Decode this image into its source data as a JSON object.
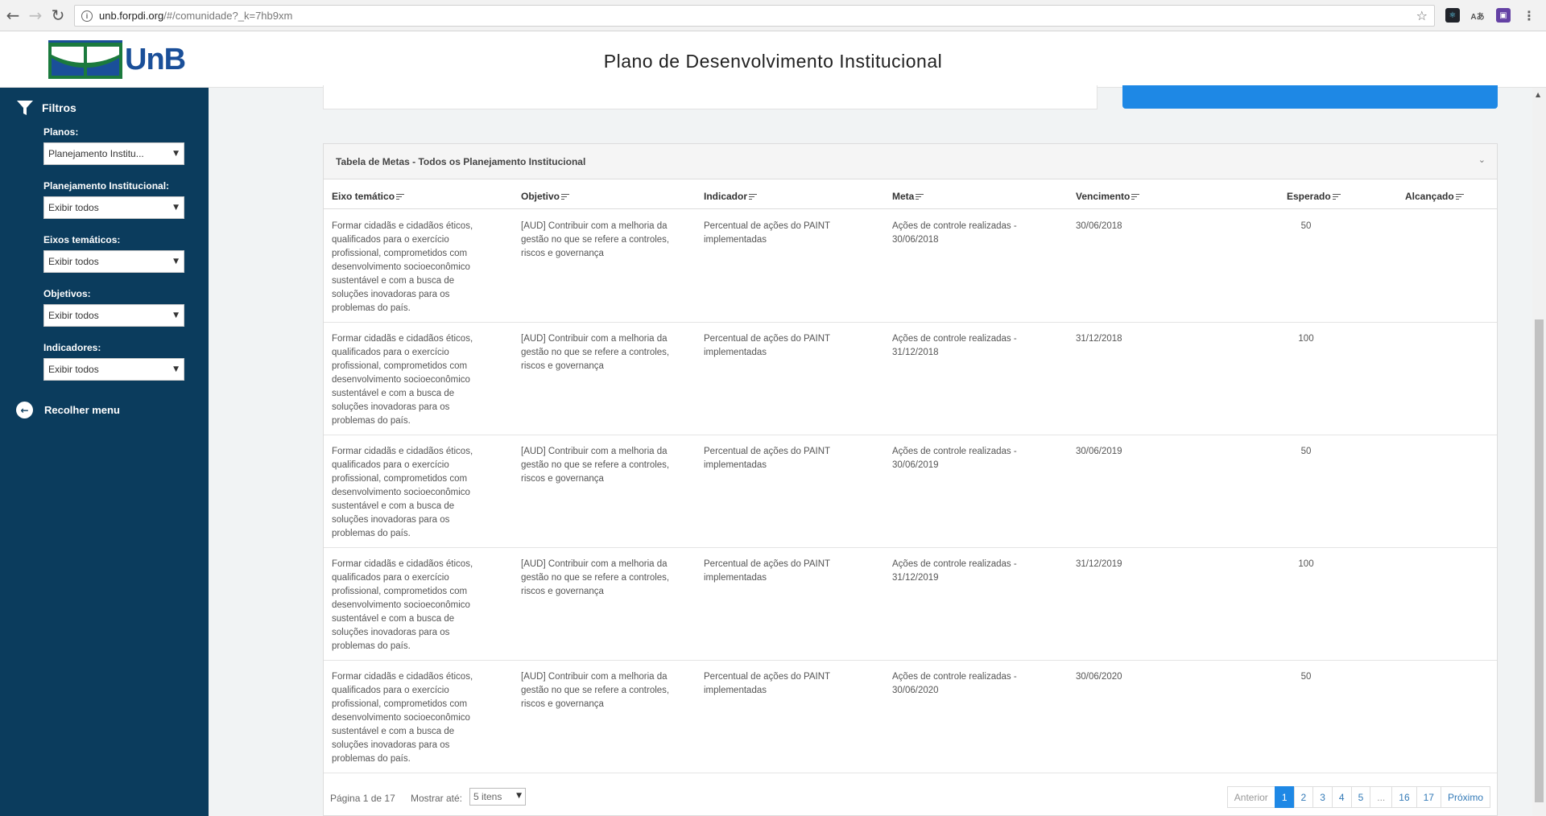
{
  "browser": {
    "url_host": "unb.forpdi.org",
    "url_path": "/#/comunidade?_k=7hb9xm"
  },
  "header": {
    "logo_text": "UnB",
    "title": "Plano de Desenvolvimento Institucional"
  },
  "sidebar": {
    "filters_title": "Filtros",
    "filters": [
      {
        "label": "Planos:",
        "value": "Planejamento Institu..."
      },
      {
        "label": "Planejamento Institucional:",
        "value": "Exibir todos"
      },
      {
        "label": "Eixos temáticos:",
        "value": "Exibir todos"
      },
      {
        "label": "Objetivos:",
        "value": "Exibir todos"
      },
      {
        "label": "Indicadores:",
        "value": "Exibir todos"
      }
    ],
    "collapse_label": "Recolher menu"
  },
  "table": {
    "title": "Tabela de Metas - Todos os Planejamento Institucional",
    "columns": [
      "Eixo temático",
      "Objetivo",
      "Indicador",
      "Meta",
      "Vencimento",
      "Esperado",
      "Alcançado"
    ],
    "rows": [
      {
        "eixo": "Formar cidadãs e cidadãos éticos, qualificados para o exercício profissional, comprometidos com desenvolvimento socioeconômico sustentável e com a busca de soluções inovadoras para os problemas do país.",
        "objetivo": "[AUD] Contribuir com a melhoria da gestão no que se refere a controles, riscos e governança",
        "indicador": "Percentual de ações do PAINT implementadas",
        "meta": "Ações de controle realizadas - 30/06/2018",
        "vencimento": "30/06/2018",
        "esperado": "50",
        "alcancado": ""
      },
      {
        "eixo": "Formar cidadãs e cidadãos éticos, qualificados para o exercício profissional, comprometidos com desenvolvimento socioeconômico sustentável e com a busca de soluções inovadoras para os problemas do país.",
        "objetivo": "[AUD] Contribuir com a melhoria da gestão no que se refere a controles, riscos e governança",
        "indicador": "Percentual de ações do PAINT implementadas",
        "meta": "Ações de controle realizadas - 31/12/2018",
        "vencimento": "31/12/2018",
        "esperado": "100",
        "alcancado": ""
      },
      {
        "eixo": "Formar cidadãs e cidadãos éticos, qualificados para o exercício profissional, comprometidos com desenvolvimento socioeconômico sustentável e com a busca de soluções inovadoras para os problemas do país.",
        "objetivo": "[AUD] Contribuir com a melhoria da gestão no que se refere a controles, riscos e governança",
        "indicador": "Percentual de ações do PAINT implementadas",
        "meta": "Ações de controle realizadas - 30/06/2019",
        "vencimento": "30/06/2019",
        "esperado": "50",
        "alcancado": ""
      },
      {
        "eixo": "Formar cidadãs e cidadãos éticos, qualificados para o exercício profissional, comprometidos com desenvolvimento socioeconômico sustentável e com a busca de soluções inovadoras para os problemas do país.",
        "objetivo": "[AUD] Contribuir com a melhoria da gestão no que se refere a controles, riscos e governança",
        "indicador": "Percentual de ações do PAINT implementadas",
        "meta": "Ações de controle realizadas - 31/12/2019",
        "vencimento": "31/12/2019",
        "esperado": "100",
        "alcancado": ""
      },
      {
        "eixo": "Formar cidadãs e cidadãos éticos, qualificados para o exercício profissional, comprometidos com desenvolvimento socioeconômico sustentável e com a busca de soluções inovadoras para os problemas do país.",
        "objetivo": "[AUD] Contribuir com a melhoria da gestão no que se refere a controles, riscos e governança",
        "indicador": "Percentual de ações do PAINT implementadas",
        "meta": "Ações de controle realizadas - 30/06/2020",
        "vencimento": "30/06/2020",
        "esperado": "50",
        "alcancado": ""
      }
    ]
  },
  "pagination": {
    "page_info": "Página 1 de 17",
    "show_label": "Mostrar até:",
    "show_value": "5 itens",
    "prev": "Anterior",
    "pages": [
      "1",
      "2",
      "3",
      "4",
      "5",
      "...",
      "16",
      "17"
    ],
    "next": "Próximo",
    "current": "1"
  },
  "colors": {
    "sidebar_bg": "#0b3c5d",
    "accent_blue": "#1e88e5",
    "logo_green": "#1b7a3d",
    "logo_blue": "#1a4f99"
  }
}
